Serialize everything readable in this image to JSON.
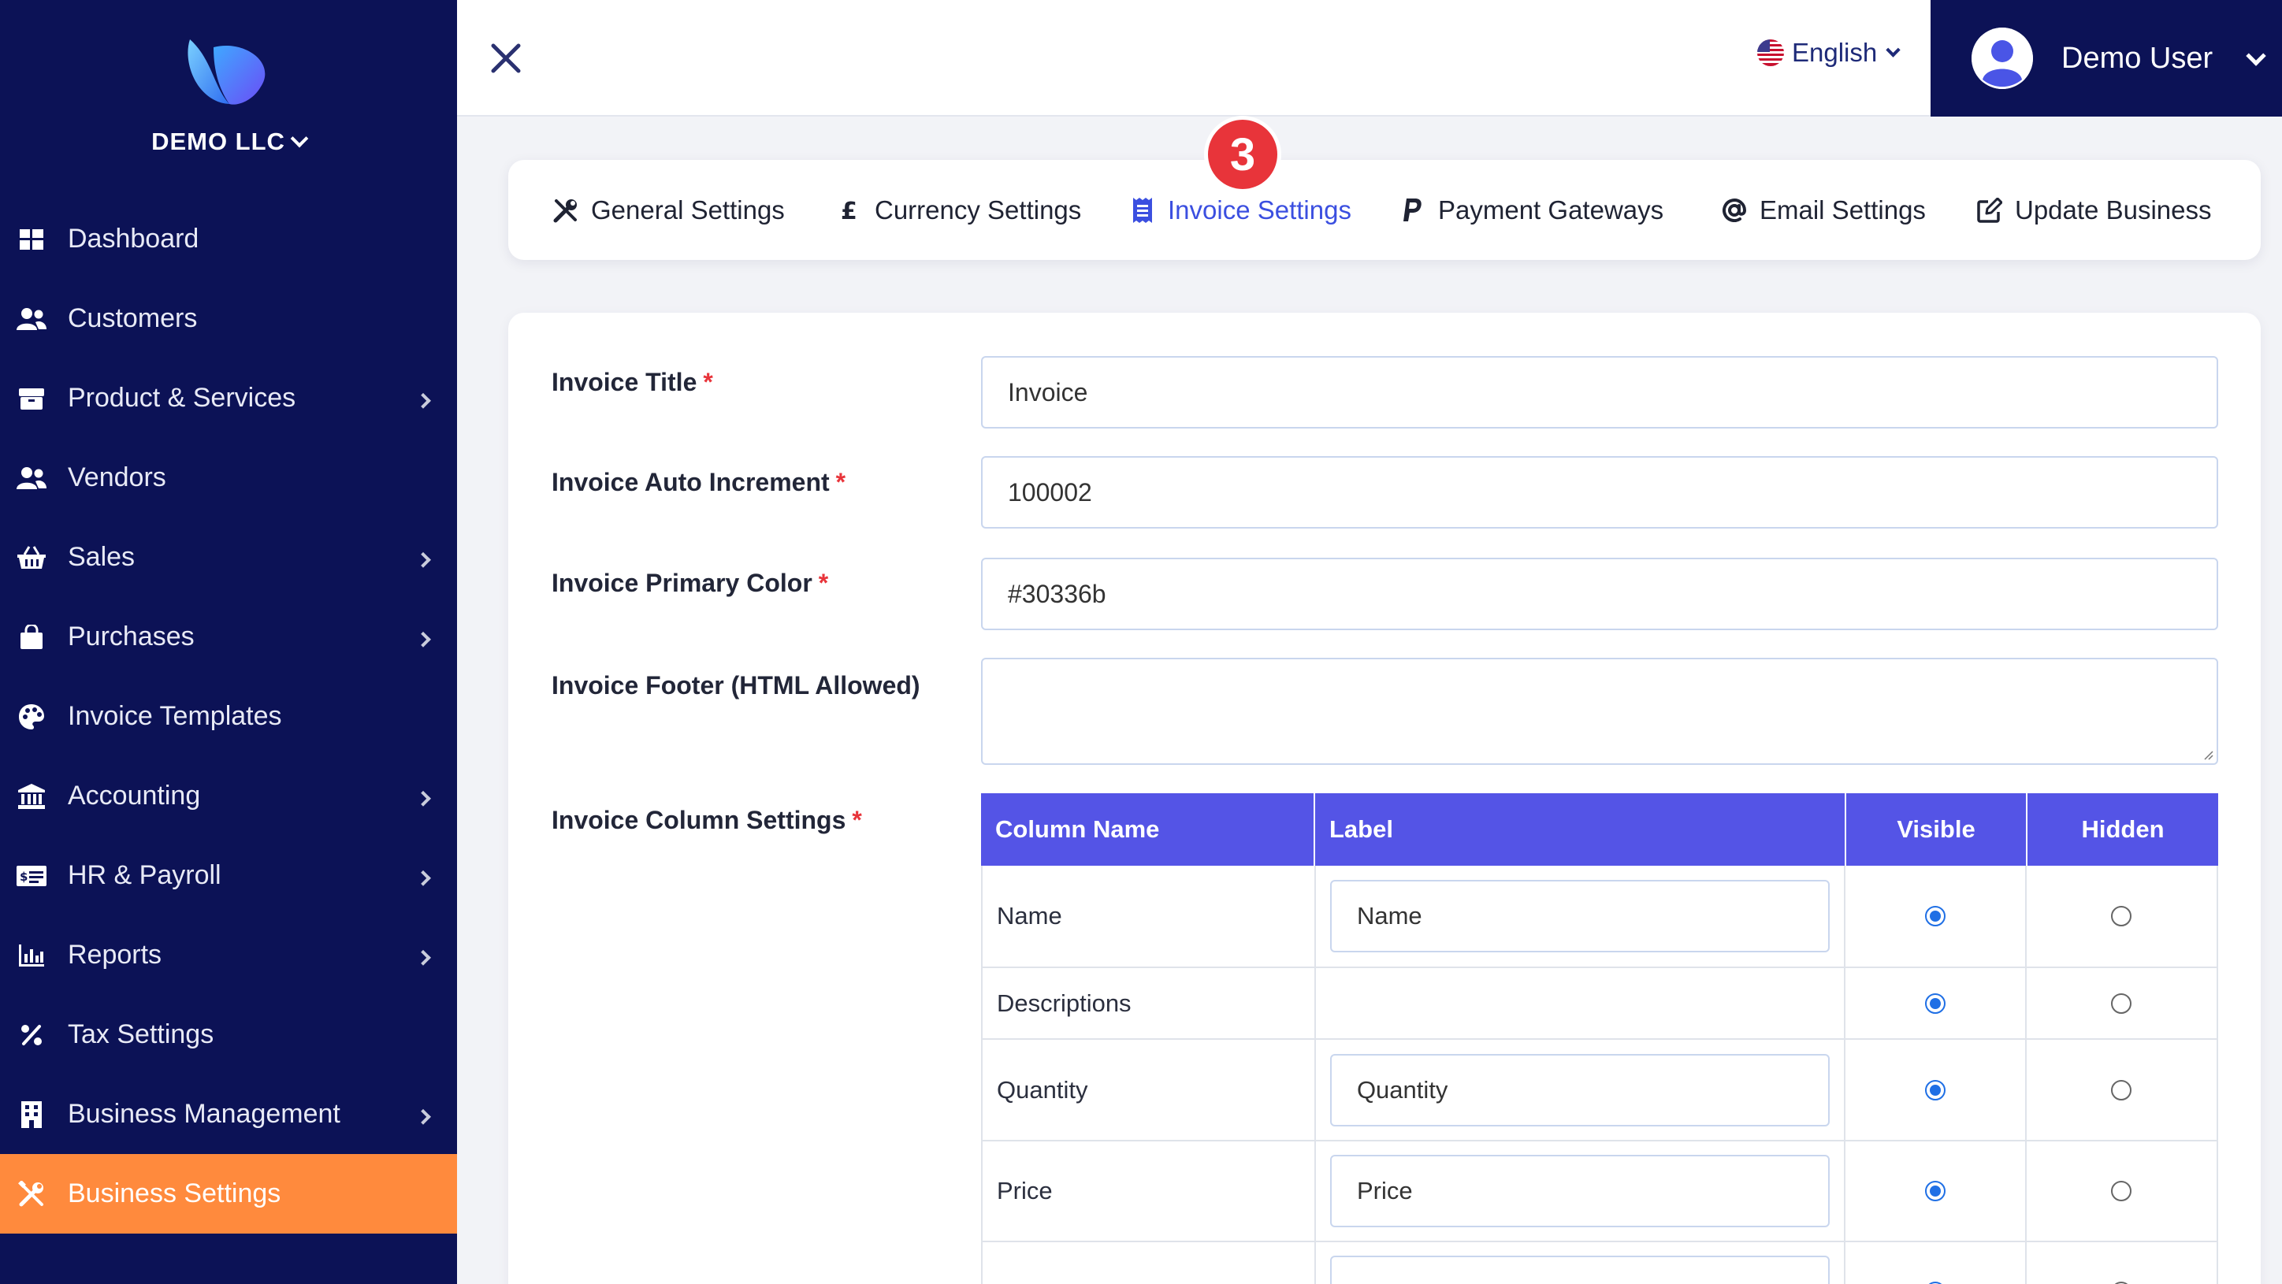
{
  "sidebar": {
    "company": "DEMO LLC",
    "items": [
      {
        "label": "Dashboard",
        "icon": "dashboard-icon"
      },
      {
        "label": "Customers",
        "icon": "users-icon"
      },
      {
        "label": "Product & Services",
        "icon": "box-icon",
        "has_submenu": true
      },
      {
        "label": "Vendors",
        "icon": "users-icon"
      },
      {
        "label": "Sales",
        "icon": "basket-icon",
        "has_submenu": true
      },
      {
        "label": "Purchases",
        "icon": "bag-icon",
        "has_submenu": true
      },
      {
        "label": "Invoice Templates",
        "icon": "palette-icon"
      },
      {
        "label": "Accounting",
        "icon": "bank-icon",
        "has_submenu": true
      },
      {
        "label": "HR & Payroll",
        "icon": "money-bill-icon",
        "has_submenu": true
      },
      {
        "label": "Reports",
        "icon": "bar-chart-icon",
        "has_submenu": true
      },
      {
        "label": "Tax Settings",
        "icon": "percent-icon"
      },
      {
        "label": "Business Management",
        "icon": "building-icon",
        "has_submenu": true
      },
      {
        "label": "Business Settings",
        "icon": "tools-icon",
        "active": true
      }
    ]
  },
  "topbar": {
    "language": "English",
    "user_name": "Demo User"
  },
  "tabs": [
    {
      "label": "General Settings",
      "icon": "tools-icon"
    },
    {
      "label": "Currency Settings",
      "icon": "pound-icon"
    },
    {
      "label": "Invoice Settings",
      "icon": "receipt-icon",
      "active": true
    },
    {
      "label": "Payment Gateways",
      "icon": "paypal-icon"
    },
    {
      "label": "Email Settings",
      "icon": "at-icon"
    },
    {
      "label": "Update Business",
      "icon": "edit-icon"
    }
  ],
  "step_badge": "3",
  "form": {
    "title_label": "Invoice Title",
    "title_value": "Invoice",
    "auto_increment_label": "Invoice Auto Increment",
    "auto_increment_value": "100002",
    "primary_color_label": "Invoice Primary Color",
    "primary_color_value": "#30336b",
    "footer_label": "Invoice Footer (HTML Allowed)",
    "footer_value": "",
    "columns_label": "Invoice Column Settings",
    "required_mark": "*"
  },
  "column_table": {
    "headers": [
      "Column Name",
      "Label",
      "Visible",
      "Hidden"
    ],
    "rows": [
      {
        "name": "Name",
        "label": "Name",
        "visible": true
      },
      {
        "name": "Descriptions",
        "label": null,
        "visible": true
      },
      {
        "name": "Quantity",
        "label": "Quantity",
        "visible": true
      },
      {
        "name": "Price",
        "label": "Price",
        "visible": true
      }
    ]
  },
  "colors": {
    "sidebar_bg": "#0c1256",
    "active_item": "#ff8a3d",
    "table_header": "#5454e6",
    "tab_active": "#3b4fe0",
    "badge": "#e8343a"
  }
}
